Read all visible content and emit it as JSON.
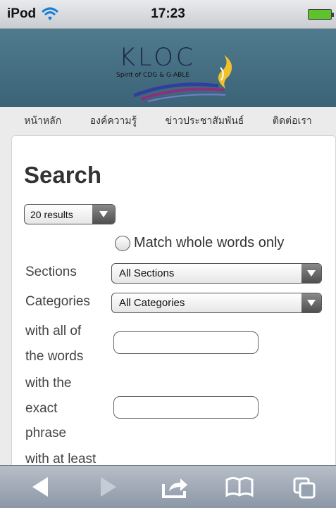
{
  "status_bar": {
    "carrier": "iPod",
    "time": "17:23",
    "icons": [
      "wifi-icon",
      "battery-icon"
    ]
  },
  "banner": {
    "logo_text": "KLOC",
    "logo_subtitle": "Spirit of CDG & G-ABLE",
    "colors": {
      "background": "#47707f",
      "wave_blue": "#2f3f9a",
      "wave_purple": "#8c2f7f",
      "flame": "#f0c12c"
    }
  },
  "nav": {
    "items": [
      "หน้าหลัก",
      "องค์ความรู้",
      "ข่าวประชาสัมพันธ์",
      "ติดต่อเรา"
    ]
  },
  "search": {
    "title": "Search",
    "results_select": "20 results",
    "match_whole_words_label": "Match whole words only",
    "match_whole_words_checked": false,
    "sections_label": "Sections",
    "sections_value": "All Sections",
    "categories_label": "Categories",
    "categories_value": "All Categories",
    "all_words_label_line1": "with all of",
    "all_words_label_line2": "the words",
    "all_words_value": "",
    "exact_phrase_label_line1": "with the",
    "exact_phrase_label_line2": "exact",
    "exact_phrase_label_line3": "phrase",
    "exact_phrase_value": "",
    "at_least_label": "with at least"
  },
  "toolbar": {
    "buttons": [
      "back-icon",
      "forward-icon",
      "share-icon",
      "bookmarks-icon",
      "tabs-icon"
    ]
  }
}
